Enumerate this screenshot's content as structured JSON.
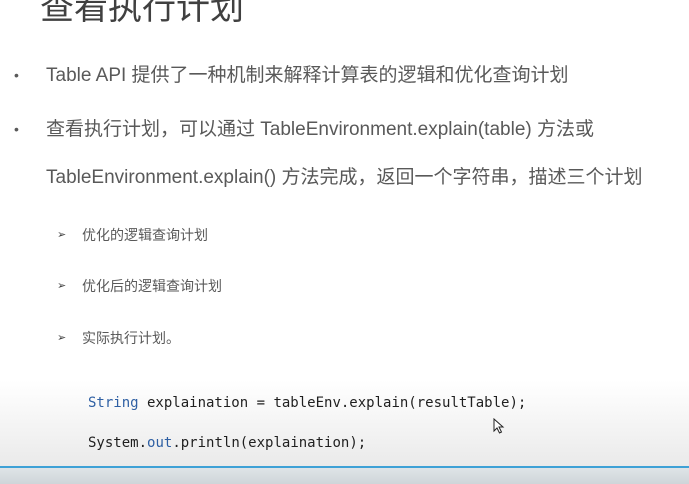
{
  "title": "查看执行计划",
  "bullets": [
    {
      "marker": "•",
      "lines": [
        "Table API 提供了一种机制来解释计算表的逻辑和优化查询计划"
      ]
    },
    {
      "marker": "•",
      "lines": [
        "查看执行计划，可以通过 TableEnvironment.explain(table) 方法或",
        "TableEnvironment.explain() 方法完成，返回一个字符串，描述三个计划"
      ]
    }
  ],
  "sub_marker": "➢",
  "sub_items": [
    "优化的逻辑查询计划",
    "优化后的逻辑查询计划",
    "实际执行计划。"
  ],
  "code": {
    "line1": {
      "type": "String",
      "rest": " explaination = tableEnv.explain(resultTable);"
    },
    "line2": {
      "obj": "System.",
      "field": "out",
      "rest": ".println(explaination);"
    }
  },
  "colors": {
    "text": "#595959",
    "code_keyword": "#2e5fa3",
    "accent_bar": "#3ea1d6"
  },
  "icons": [
    "mouse-pointer-icon"
  ]
}
